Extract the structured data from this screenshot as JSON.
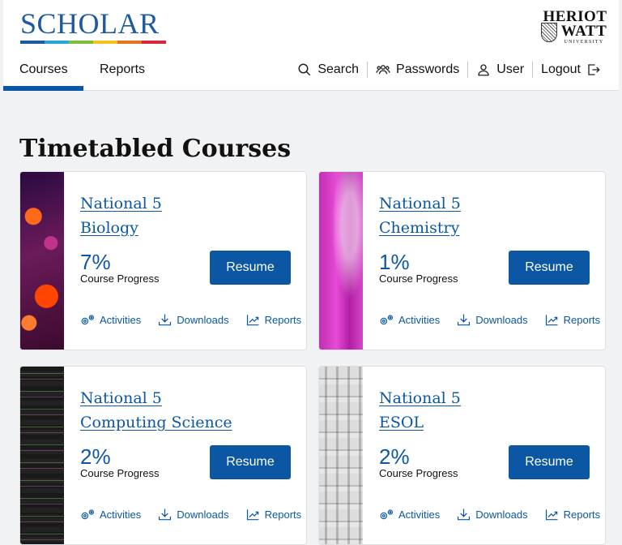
{
  "header": {
    "logo": "SCHOLAR",
    "logo_bar_colors": [
      "#1e5aa0",
      "#2aa6d6",
      "#7bbf3a",
      "#f3c21b",
      "#e8731f",
      "#d7263d"
    ],
    "university": {
      "line1": "HERIOT",
      "line2": "WATT",
      "line3": "UNIVERSITY"
    }
  },
  "nav": {
    "tabs": [
      {
        "label": "Courses",
        "active": true
      },
      {
        "label": "Reports",
        "active": false
      }
    ],
    "search": "Search",
    "passwords": "Passwords",
    "user": "User",
    "logout": "Logout"
  },
  "page_title": "Timetabled Courses",
  "courses": [
    {
      "title_line1": "National 5",
      "title_line2": "Biology",
      "progress": "7%",
      "progress_label": "Course Progress",
      "resume": "Resume",
      "activities": "Activities",
      "downloads": "Downloads",
      "reports": "Reports"
    },
    {
      "title_line1": "National 5",
      "title_line2": "Chemistry",
      "progress": "1%",
      "progress_label": "Course Progress",
      "resume": "Resume",
      "activities": "Activities",
      "downloads": "Downloads",
      "reports": "Reports"
    },
    {
      "title_line1": "National 5",
      "title_line2": "Computing Science",
      "progress": "2%",
      "progress_label": "Course Progress",
      "resume": "Resume",
      "activities": "Activities",
      "downloads": "Downloads",
      "reports": "Reports"
    },
    {
      "title_line1": "National 5",
      "title_line2": "ESOL",
      "progress": "2%",
      "progress_label": "Course Progress",
      "resume": "Resume",
      "activities": "Activities",
      "downloads": "Downloads",
      "reports": "Reports"
    }
  ],
  "colors": {
    "primary": "#0b57a4",
    "background": "#f1f2f4"
  }
}
